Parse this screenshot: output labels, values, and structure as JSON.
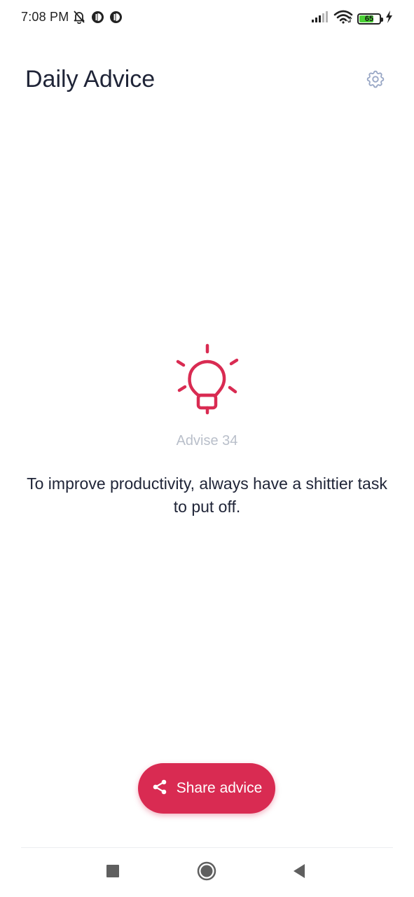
{
  "status_bar": {
    "time": "7:08 PM",
    "battery_level": "65",
    "icons": [
      "bell-off-icon",
      "app-notification-icon",
      "app-notification-icon",
      "signal-icon",
      "wifi-icon",
      "battery-icon",
      "charging-icon"
    ]
  },
  "header": {
    "title": "Daily Advice",
    "settings_icon": "gear-icon"
  },
  "advice": {
    "icon": "lightbulb-icon",
    "number_label": "Advise 34",
    "text": "To improve productivity, always have a shittier task to put off."
  },
  "share_button": {
    "icon": "share-icon",
    "label": "Share advice"
  },
  "nav_bar": {
    "recents_icon": "square-icon",
    "home_icon": "circle-icon",
    "back_icon": "triangle-back-icon"
  },
  "colors": {
    "accent": "#d92b52",
    "title_text": "#1f2437",
    "muted_text": "#b9bfca",
    "settings_icon": "#9aa8c6"
  }
}
